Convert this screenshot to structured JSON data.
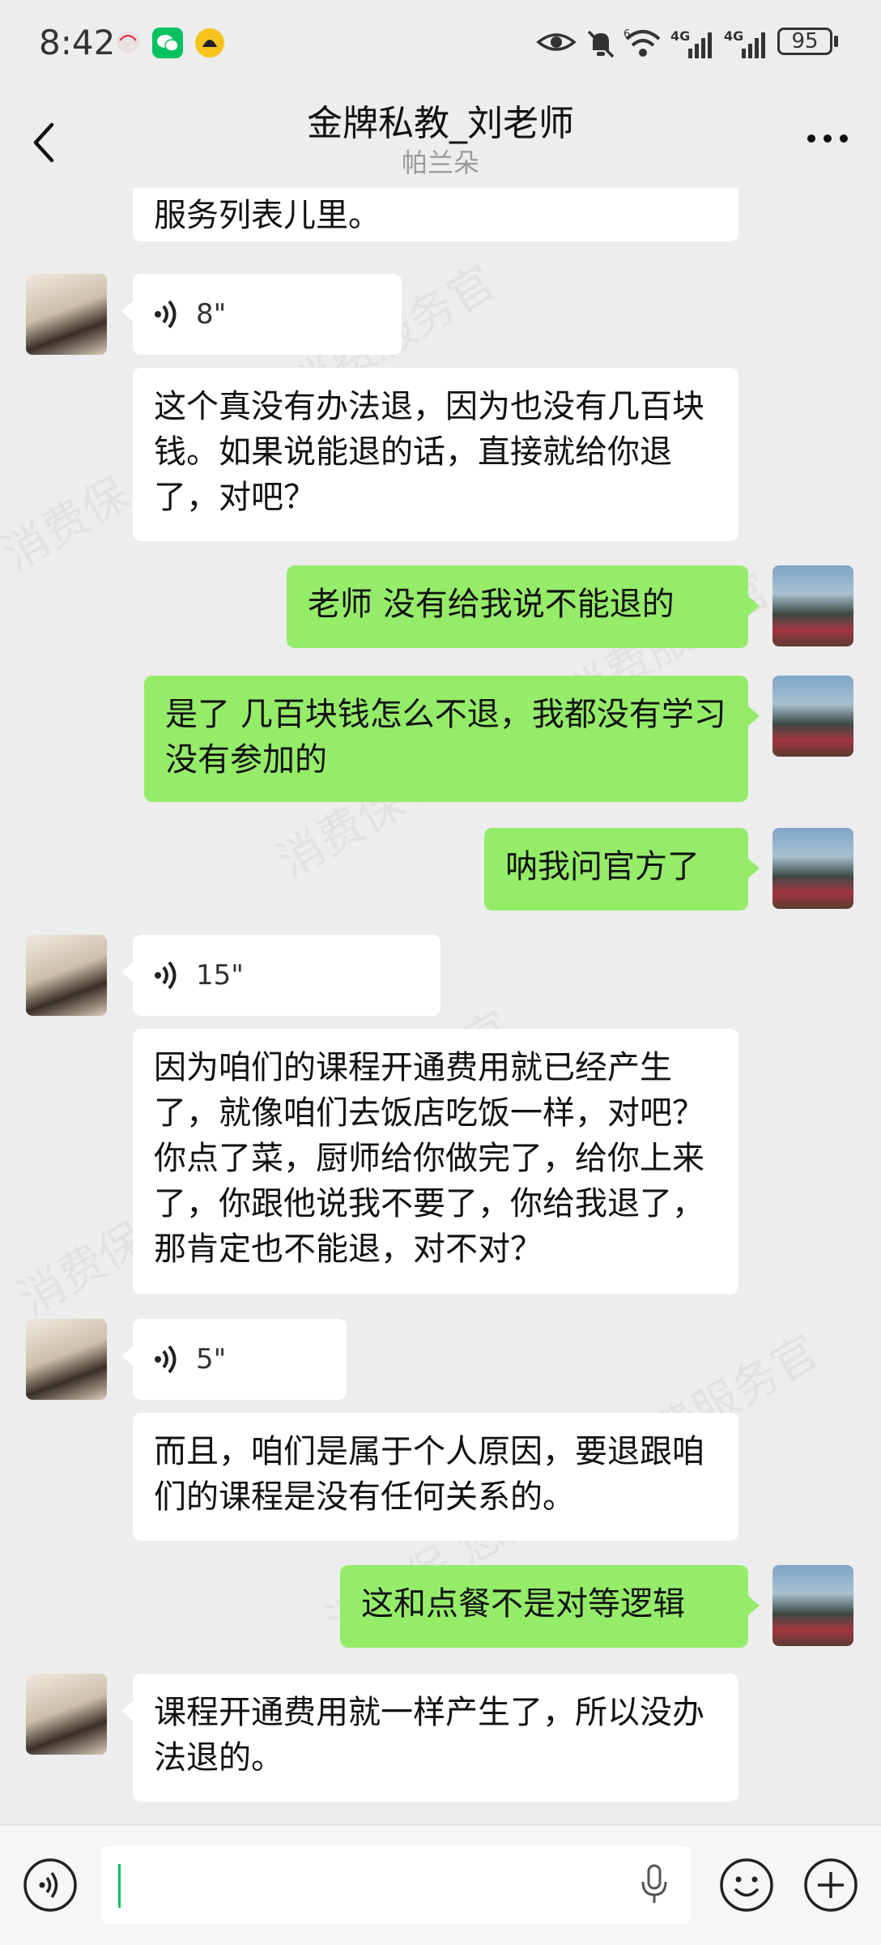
{
  "status_bar": {
    "time": "8:42",
    "battery": "95",
    "network": "4G",
    "network2": "4G",
    "wifi_badge": "6"
  },
  "header": {
    "title": "金牌私教_刘老师",
    "subtitle": "帕兰朵"
  },
  "messages": [
    {
      "side": "in",
      "type": "text",
      "text": "服务列表儿里。"
    },
    {
      "side": "in",
      "type": "voice",
      "duration": "8\""
    },
    {
      "side": "in",
      "type": "text",
      "text": "这个真没有办法退，因为也没有几百块钱。如果说能退的话，直接就给你退了，对吧？"
    },
    {
      "side": "out",
      "type": "text",
      "text": "老师  没有给我说不能退的"
    },
    {
      "side": "out",
      "type": "text",
      "text": "是了  几百块钱怎么不退，我都没有学习没有参加的"
    },
    {
      "side": "out",
      "type": "text",
      "text": "呐我问官方了"
    },
    {
      "side": "in",
      "type": "voice",
      "duration": "15\""
    },
    {
      "side": "in",
      "type": "text",
      "text": "因为咱们的课程开通费用就已经产生了，就像咱们去饭店吃饭一样，对吧？你点了菜，厨师给你做完了，给你上来了，你跟他说我不要了，你给我退了，那肯定也不能退，对不对？"
    },
    {
      "side": "in",
      "type": "voice",
      "duration": "5\""
    },
    {
      "side": "in",
      "type": "text",
      "text": "而且，咱们是属于个人原因，要退跟咱们的课程是没有任何关系的。"
    },
    {
      "side": "out",
      "type": "text",
      "text": "这和点餐不是对等逻辑"
    },
    {
      "side": "in",
      "type": "text",
      "text": "课程开通费用就一样产生了，所以没办法退的。"
    }
  ],
  "input_bar": {
    "value": ""
  },
  "colors": {
    "outgoing_bubble": "#95ec69",
    "incoming_bubble": "#ffffff",
    "background": "#ededed"
  }
}
